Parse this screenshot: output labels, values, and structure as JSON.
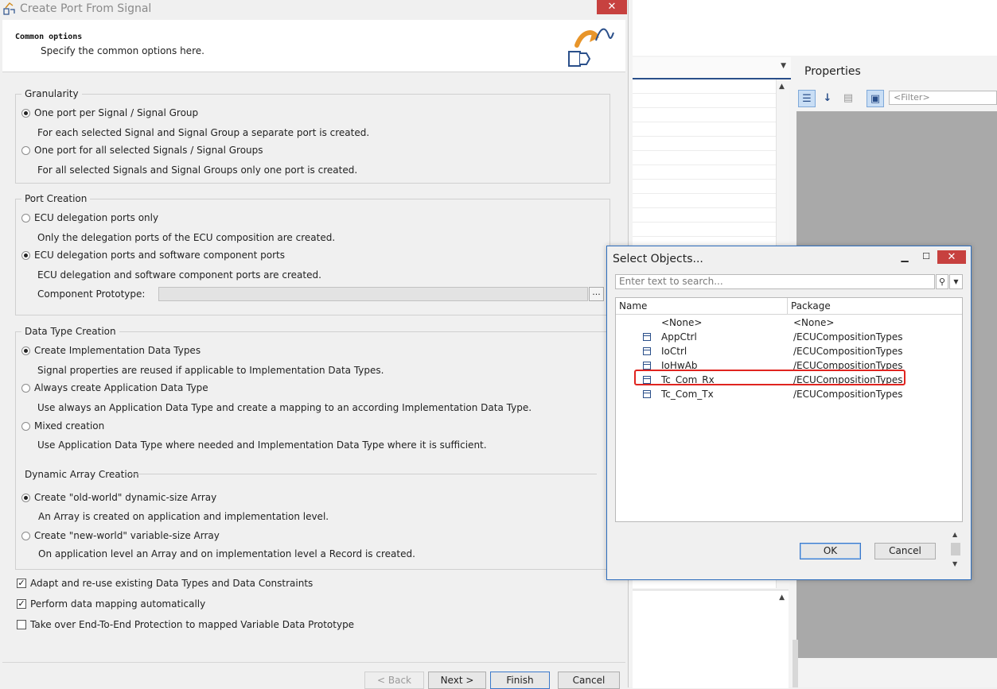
{
  "wizard": {
    "title": "Create Port From Signal",
    "close_glyph": "✕",
    "header": {
      "title": "Common options",
      "subtitle": "Specify the common options here."
    },
    "granularity": {
      "label": "Granularity",
      "options": [
        {
          "label": "One port per Signal / Signal Group",
          "description": "For each selected Signal and Signal Group a separate port is created.",
          "checked": true
        },
        {
          "label": "One port for all selected Signals / Signal Groups",
          "description": "For all selected Signals and Signal Groups only one port is created.",
          "checked": false
        }
      ]
    },
    "port_creation": {
      "label": "Port Creation",
      "options": [
        {
          "label": "ECU delegation ports only",
          "description": "Only the delegation ports of the ECU composition are created.",
          "checked": false
        },
        {
          "label": "ECU delegation ports and software component ports",
          "description": "ECU delegation and software component ports are created.",
          "checked": true
        }
      ],
      "component_prototype_label": "Component Prototype:",
      "component_prototype_value": "",
      "browse_label": "..."
    },
    "data_type_creation": {
      "label": "Data Type Creation",
      "options": [
        {
          "label": "Create Implementation Data Types",
          "description": "Signal properties are reused if applicable to Implementation Data Types.",
          "checked": true
        },
        {
          "label": "Always create Application Data Type",
          "description": "Use always an Application Data Type and create a mapping to an according Implementation Data Type.",
          "checked": false
        },
        {
          "label": "Mixed creation",
          "description": "Use Application Data Type where needed and Implementation Data Type where it is sufficient.",
          "checked": false
        }
      ],
      "dynamic_array": {
        "label": "Dynamic Array Creation",
        "options": [
          {
            "label": "Create \"old-world\" dynamic-size Array",
            "description": "An Array is created on application and implementation level.",
            "checked": true
          },
          {
            "label": "Create \"new-world\" variable-size Array",
            "description": "On application level an Array and on implementation level a Record is created.",
            "checked": false
          }
        ]
      }
    },
    "checkboxes": [
      {
        "label": "Adapt and re-use existing Data Types and Data Constraints",
        "checked": true
      },
      {
        "label": "Perform data mapping automatically",
        "checked": true
      },
      {
        "label": "Take over End-To-End Protection to mapped Variable Data Prototype",
        "checked": false
      }
    ],
    "buttons": {
      "back": "< Back",
      "next": "Next >",
      "finish": "Finish",
      "cancel": "Cancel"
    }
  },
  "background": {
    "properties_title": "Properties",
    "filter_placeholder": "<Filter>"
  },
  "select_dialog": {
    "title": "Select Objects...",
    "search_placeholder": "Enter text to search...",
    "columns": {
      "name": "Name",
      "package": "Package"
    },
    "rows": [
      {
        "name": "<None>",
        "package": "<None>",
        "icon": "none"
      },
      {
        "name": "AppCtrl",
        "package": "/ECUCompositionTypes",
        "icon": "composition-icon"
      },
      {
        "name": "IoCtrl",
        "package": "/ECUCompositionTypes",
        "icon": "composition-icon"
      },
      {
        "name": "IoHwAb",
        "package": "/ECUCompositionTypes",
        "icon": "composition-icon"
      },
      {
        "name": "Tc_Com_Rx",
        "package": "/ECUCompositionTypes",
        "icon": "composition-icon",
        "highlighted": true
      },
      {
        "name": "Tc_Com_Tx",
        "package": "/ECUCompositionTypes",
        "icon": "composition-icon"
      }
    ],
    "ok_label": "OK",
    "cancel_label": "Cancel"
  },
  "colors": {
    "accent": "#2d6dbd",
    "close_red": "#c7413f",
    "highlight_red": "#e0241f"
  }
}
